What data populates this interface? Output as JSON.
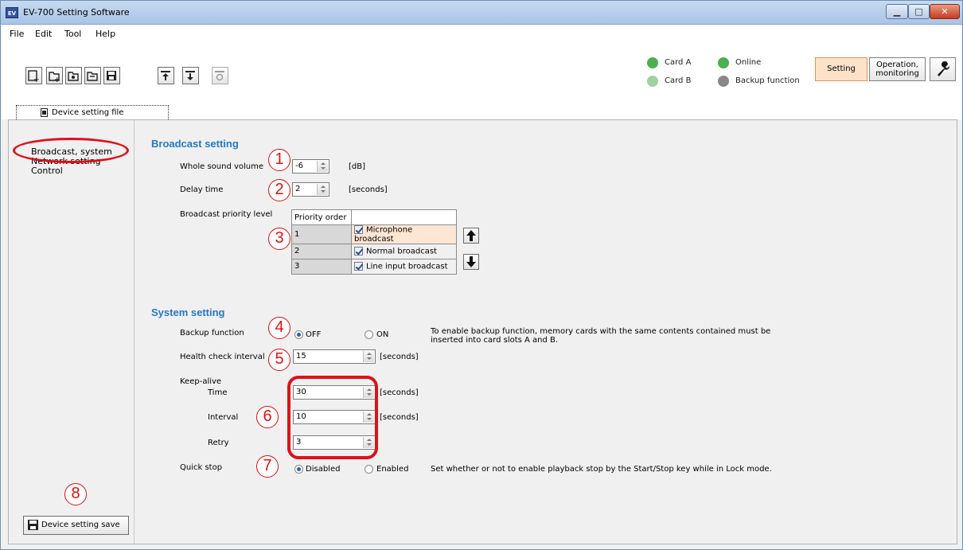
{
  "window": {
    "app_icon_text": "EV",
    "title": "EV-700 Setting Software"
  },
  "menu": {
    "items": [
      "File",
      "Edit",
      "Tool",
      "Help"
    ]
  },
  "status": {
    "card_a": "Card A",
    "card_b": "Card B",
    "online": "Online",
    "backup": "Backup function",
    "colors": {
      "ok": "#4caf50",
      "ok_dim": "#9ed2a1",
      "off": "#888888"
    }
  },
  "mode": {
    "setting": "Setting",
    "operation": "Operation, monitoring"
  },
  "tab": {
    "label": "Device setting file"
  },
  "nav": {
    "items": [
      "Broadcast, system",
      "Network setting",
      "Control"
    ]
  },
  "broadcast": {
    "title": "Broadcast setting",
    "whole_volume_label": "Whole sound volume",
    "whole_volume_value": "-6",
    "whole_volume_unit": "[dB]",
    "delay_label": "Delay time",
    "delay_value": "2",
    "delay_unit": "[seconds]",
    "priority_label": "Broadcast priority level",
    "priority_header": "Priority order",
    "priority_rows": [
      {
        "order": "1",
        "name": "Microphone broadcast"
      },
      {
        "order": "2",
        "name": "Normal broadcast"
      },
      {
        "order": "3",
        "name": "Line input broadcast"
      }
    ]
  },
  "system": {
    "title": "System setting",
    "backup_label": "Backup function",
    "backup_off": "OFF",
    "backup_on": "ON",
    "backup_note": "To enable backup function, memory cards with the same contents contained must be inserted into card slots A and B.",
    "health_label": "Health check interval",
    "health_value": "15",
    "health_unit": "[seconds]",
    "keepalive_label": "Keep-alive",
    "time_label": "Time",
    "time_value": "30",
    "time_unit": "[seconds]",
    "interval_label": "Interval",
    "interval_value": "10",
    "interval_unit": "[seconds]",
    "retry_label": "Retry",
    "retry_value": "3",
    "quickstop_label": "Quick stop",
    "quickstop_disabled": "Disabled",
    "quickstop_enabled": "Enabled",
    "quickstop_note": "Set whether or not to enable playback stop by the Start/Stop key while in Lock mode."
  },
  "save_button": "Device setting save",
  "callouts": [
    "1",
    "2",
    "3",
    "4",
    "5",
    "6",
    "7",
    "8"
  ],
  "annotation_color": "#e0101a"
}
